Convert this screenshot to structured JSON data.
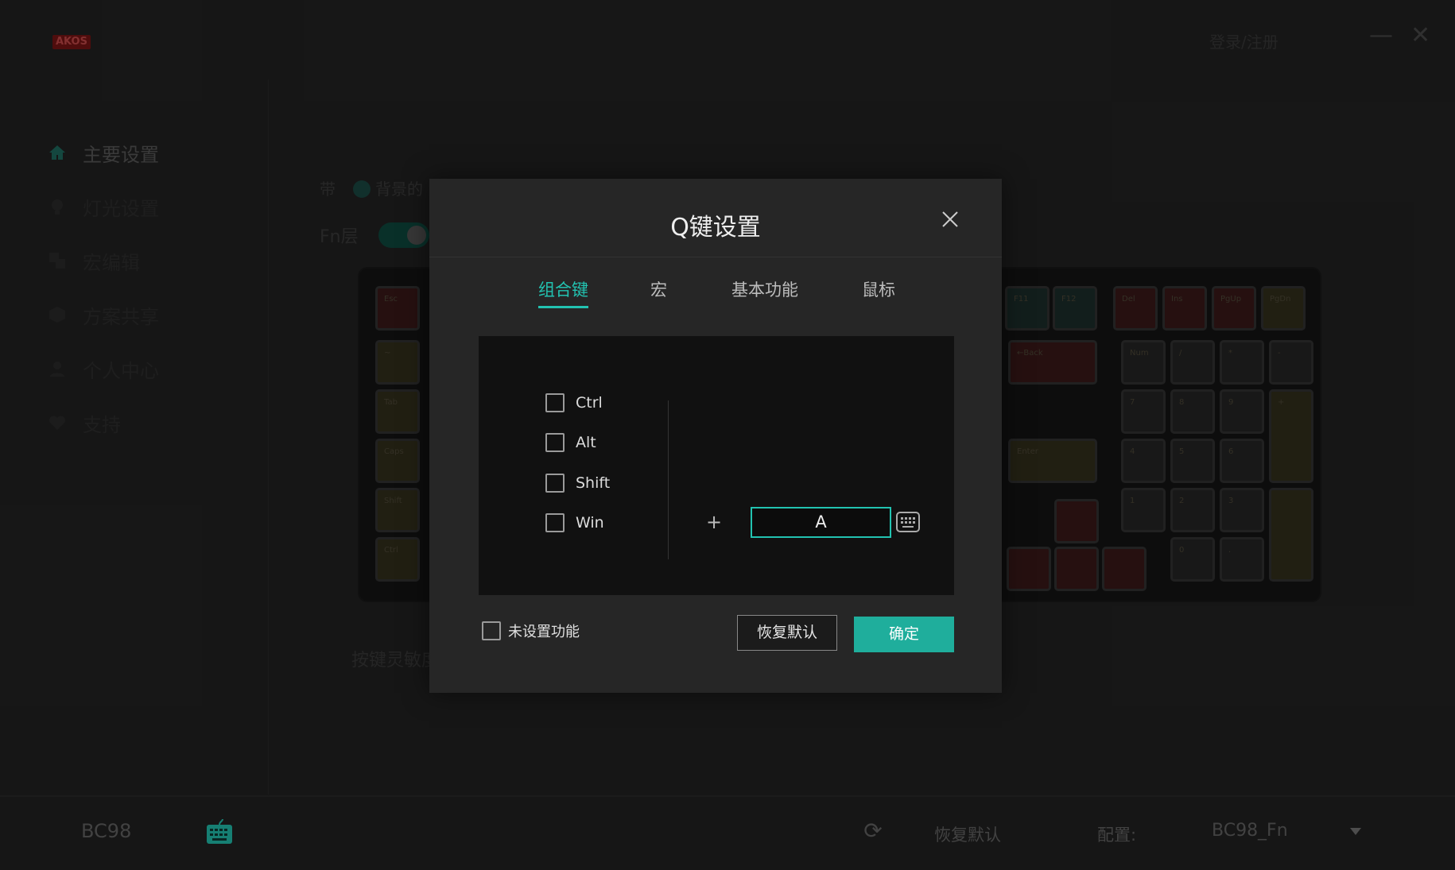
{
  "app": {
    "logo": "AKOS",
    "login": "登录/注册"
  },
  "sidebar": {
    "items": [
      {
        "label": "主要设置",
        "icon": "home-icon"
      },
      {
        "label": "灯光设置",
        "icon": "bulb-icon"
      },
      {
        "label": "宏编辑",
        "icon": "macro-icon"
      },
      {
        "label": "方案共享",
        "icon": "share-icon"
      },
      {
        "label": "个人中心",
        "icon": "user-icon"
      },
      {
        "label": "支持",
        "icon": "heart-icon"
      }
    ]
  },
  "main": {
    "band_label": "带",
    "background_text": "背景的",
    "fn_label": "Fn层",
    "sensitivity_label": "按键灵敏度"
  },
  "keyboard": {
    "keys": [
      "Esc",
      "F11",
      "F12",
      "Del",
      "Ins",
      "PgUp",
      "PgDn",
      "~",
      "←Back",
      "Num",
      "/",
      "*",
      "-",
      "Tab",
      "7",
      "8",
      "9",
      "+",
      "Caps",
      "4",
      "5",
      "6",
      "Enter",
      "Shift",
      "1",
      "2",
      "3",
      "Ctrl",
      "0",
      "."
    ]
  },
  "dialog": {
    "title": "Q键设置",
    "tabs": [
      "组合键",
      "宏",
      "基本功能",
      "鼠标"
    ],
    "modifiers": [
      "Ctrl",
      "Alt",
      "Shift",
      "Win"
    ],
    "plus": "+",
    "key_value": "A",
    "unset_label": "未设置功能",
    "restore_button": "恢复默认",
    "confirm_button": "确定",
    "accent_color": "#1fae9c"
  },
  "statusbar": {
    "device": "BC98",
    "restore": "恢复默认",
    "config_label": "配置:",
    "config_value": "BC98_Fn"
  }
}
